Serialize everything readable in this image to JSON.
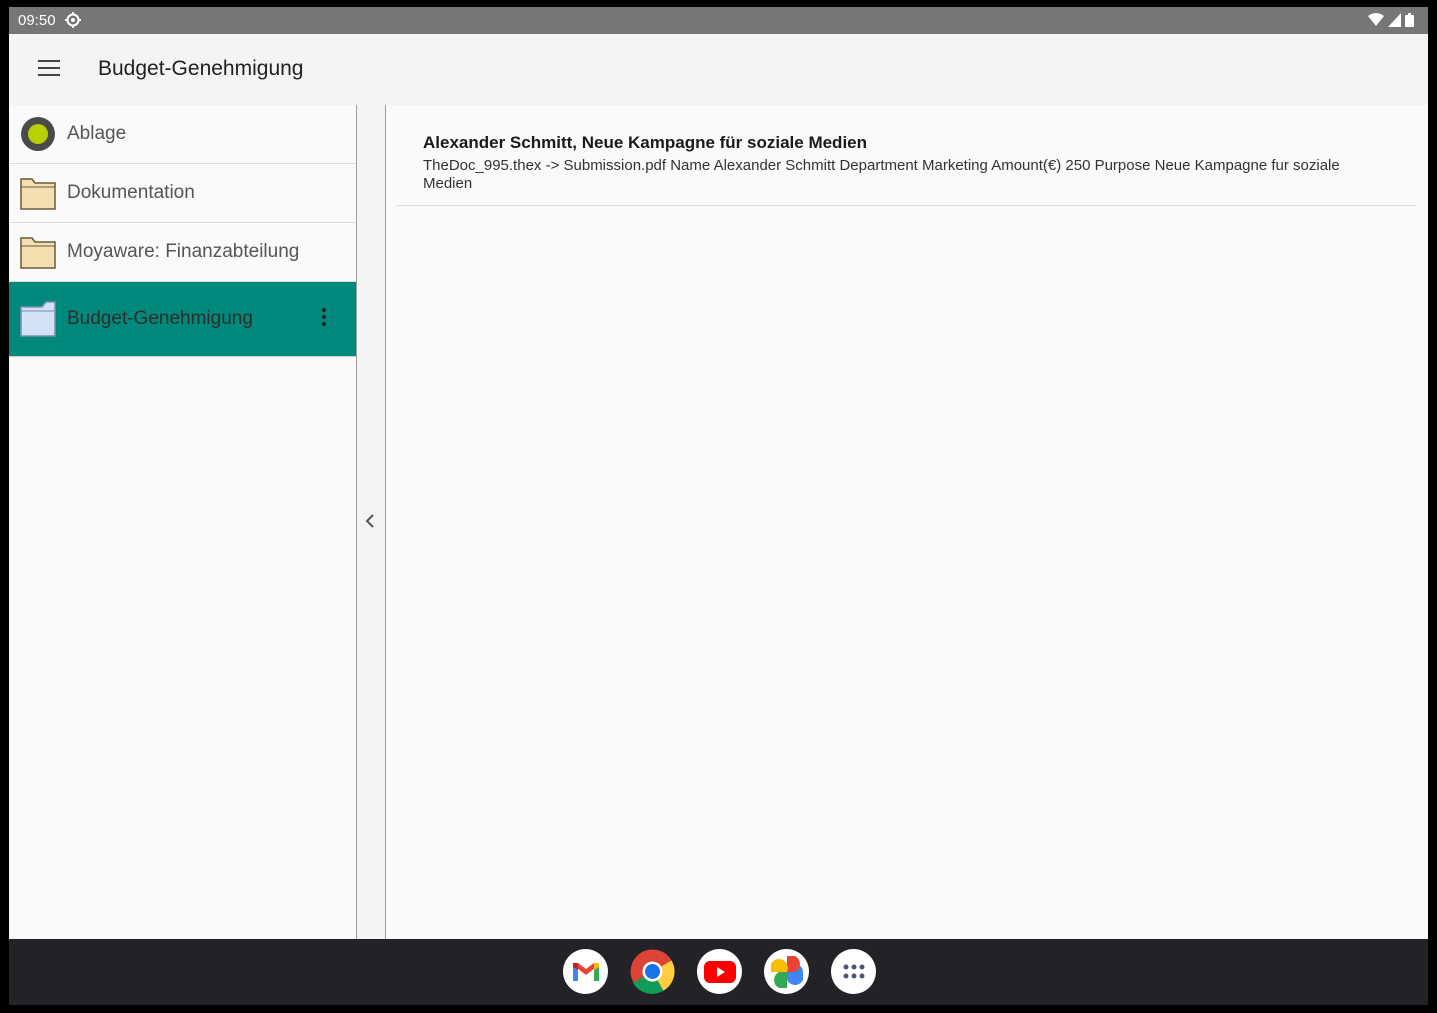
{
  "status": {
    "time": "09:50"
  },
  "appbar": {
    "title": "Budget-Genehmigung"
  },
  "sidebar": {
    "items": [
      {
        "label": "Ablage",
        "icon": "ablage-circle-icon"
      },
      {
        "label": "Dokumentation",
        "icon": "folder-icon"
      },
      {
        "label": "Moyaware: Finanzabteilung",
        "icon": "folder-icon"
      },
      {
        "label": "Budget-Genehmigung",
        "icon": "folder-open-icon",
        "active": true
      }
    ]
  },
  "content": {
    "results": [
      {
        "title": "Alexander Schmitt, Neue Kampagne für soziale Medien",
        "snippet": "TheDoc_995.thex -> Submission.pdf Name Alexander Schmitt Department Marketing Amount(€) 250 Purpose Neue Kampagne fur soziale Medien"
      }
    ]
  },
  "dock": {
    "apps": [
      "gmail-icon",
      "chrome-icon",
      "youtube-icon",
      "photos-icon",
      "app-drawer-icon"
    ]
  },
  "colors": {
    "accent": "#00897b",
    "statusbar": "#767676",
    "dock": "#232327"
  }
}
